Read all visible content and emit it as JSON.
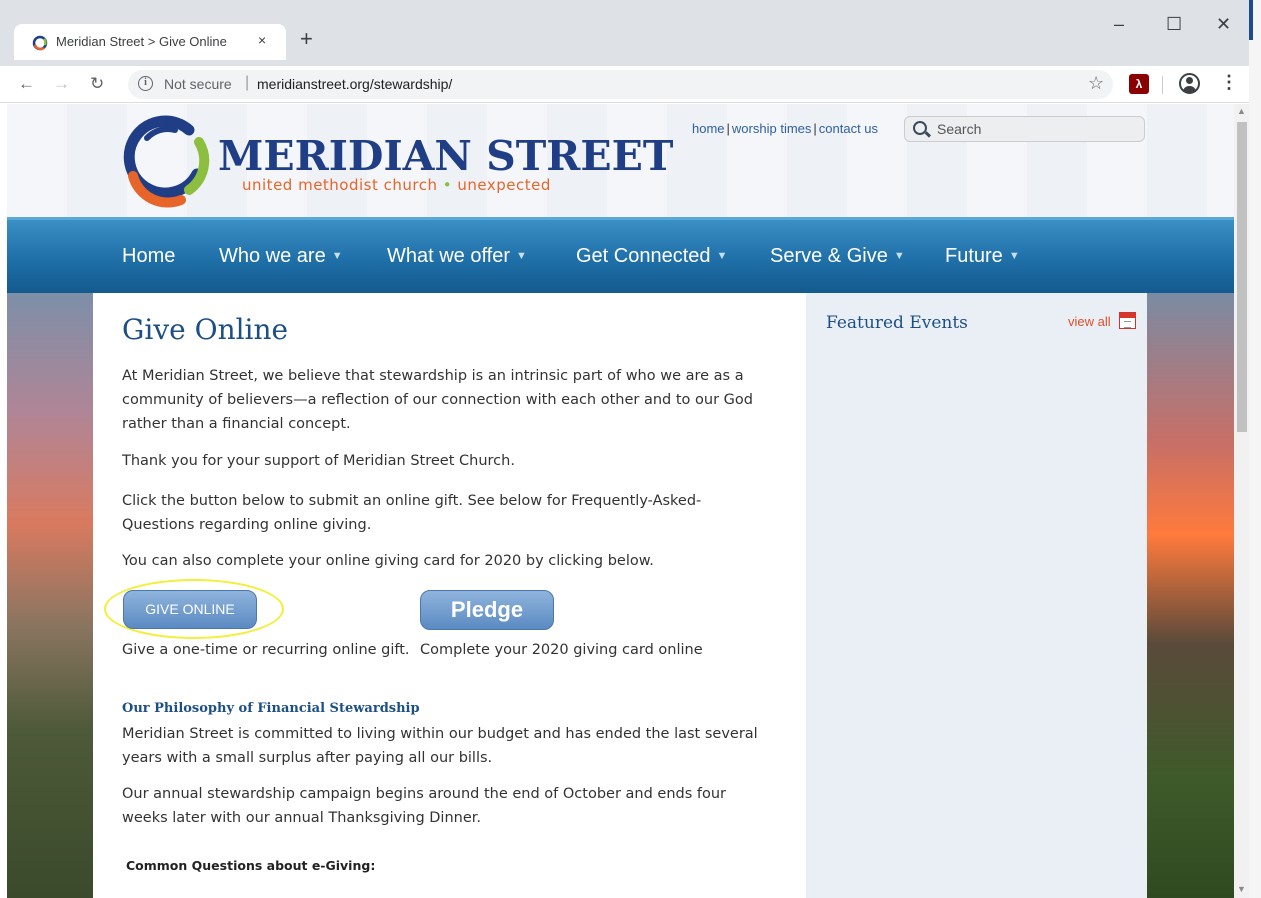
{
  "browser": {
    "tab_title": "Meridian Street > Give Online",
    "tab_close": "×",
    "new_tab": "+",
    "security_label": "Not secure",
    "url": "meridianstreet.org/stewardship/",
    "window_controls": {
      "minimize": "–",
      "maximize": "☐",
      "close": "✕"
    },
    "icons": [
      "back-icon",
      "forward-icon",
      "reload-icon",
      "info-icon",
      "star-icon",
      "pdf-extension-icon",
      "account-icon",
      "menu-icon"
    ],
    "pdf_icon_text": "λ"
  },
  "site": {
    "name": "MERIDIAN STREET",
    "tagline_part1": "united methodist church",
    "tagline_dot": "•",
    "tagline_part2": "unexpected",
    "util_links": [
      "home",
      "worship times",
      "contact us"
    ],
    "search_placeholder": "Search",
    "nav": [
      "Home",
      "Who we are",
      "What we offer",
      "Get Connected",
      "Serve & Give",
      "Future"
    ],
    "brand_colors": {
      "navy": "#1f3e86",
      "orange": "#e8652a",
      "green": "#8cbf3f",
      "nav_blue": "#1f6fa8"
    }
  },
  "content": {
    "title": "Give Online",
    "para1": "At Meridian Street, we believe that stewardship is an intrinsic part of who we are as a community of believers—a reflection of our connection with each other and to our God rather than a financial concept.",
    "para2": "Thank you for your support of Meridian Street Church.",
    "para3": "Click the button below to submit an online gift. See below for Frequently-Asked-Questions regarding online giving.",
    "para4": "You can also complete your online giving card for 2020 by clicking below.",
    "give_button": "GIVE ONLINE",
    "pledge_button": "Pledge",
    "give_caption": "Give a one-time or recurring online gift.",
    "pledge_caption": "Complete your 2020 giving card online",
    "philosophy_heading": "Our Philosophy of Financial Stewardship",
    "para5": "Meridian Street is committed to living within our budget and has ended the last several years with a small surplus after paying all our bills.",
    "para6": "Our annual stewardship campaign begins around the end of October and ends four weeks later with our annual Thanksgiving Dinner.",
    "questions_heading": "Common Questions about e-Giving:"
  },
  "sidebar": {
    "featured_title": "Featured Events",
    "view_all": "view all"
  }
}
